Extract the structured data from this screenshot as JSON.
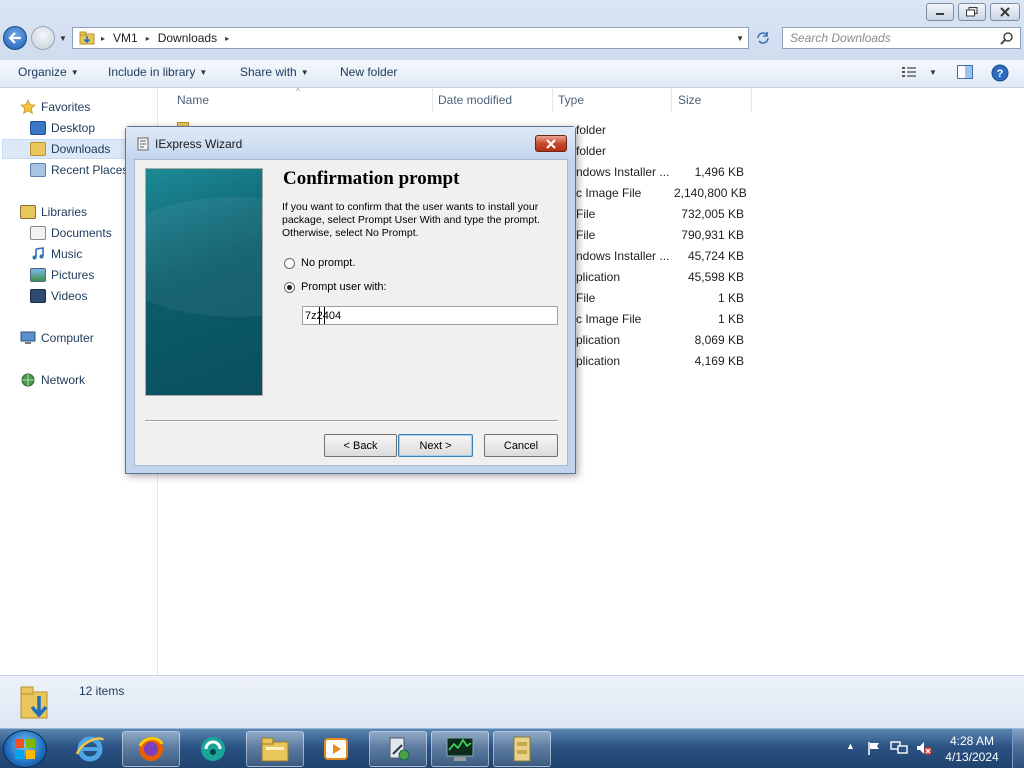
{
  "window": {
    "minimize_icon": "minimize-icon",
    "maximize_icon": "restore-icon",
    "close_icon": "close-icon"
  },
  "address": {
    "segments": [
      "VM1",
      "Downloads"
    ],
    "separator": "▸"
  },
  "search": {
    "placeholder": "Search Downloads"
  },
  "toolbar": {
    "organize": "Organize",
    "include_in_library": "Include in library",
    "share_with": "Share with",
    "new_folder": "New folder"
  },
  "nav": {
    "favorites": "Favorites",
    "desktop": "Desktop",
    "downloads": "Downloads",
    "recent_places": "Recent Places",
    "libraries": "Libraries",
    "documents": "Documents",
    "music": "Music",
    "pictures": "Pictures",
    "videos": "Videos",
    "computer": "Computer",
    "network": "Network"
  },
  "columns": {
    "name": "Name",
    "date_modified": "Date modified",
    "type": "Type",
    "size": "Size"
  },
  "files": [
    {
      "type": "folder",
      "size": ""
    },
    {
      "type": "folder",
      "size": ""
    },
    {
      "type": "ndows Installer ...",
      "size": "1,496 KB"
    },
    {
      "type": "c Image File",
      "size": "2,140,800 KB"
    },
    {
      "type": "File",
      "size": "732,005 KB"
    },
    {
      "type": "File",
      "size": "790,931 KB"
    },
    {
      "type": "ndows Installer ...",
      "size": "45,724 KB"
    },
    {
      "type": "plication",
      "size": "45,598 KB"
    },
    {
      "type": "File",
      "size": "1 KB"
    },
    {
      "type": "c Image File",
      "size": "1 KB"
    },
    {
      "type": "plication",
      "size": "8,069 KB"
    },
    {
      "type": "plication",
      "size": "4,169 KB"
    }
  ],
  "status": {
    "item_count": "12 items"
  },
  "dialog": {
    "title": "IExpress Wizard",
    "heading": "Confirmation prompt",
    "description": "If you want to confirm that the user wants to install your package, select Prompt User With and type the prompt. Otherwise, select No Prompt.",
    "option_no_prompt": "No prompt.",
    "option_prompt_user": "Prompt user with:",
    "selected_option": "prompt_user",
    "prompt_value": "7z2404",
    "back_label": "< Back",
    "next_label": "Next >",
    "cancel_label": "Cancel"
  },
  "taskbar": {
    "items": [
      "start-orb",
      "internet-explorer-icon",
      "firefox-icon",
      "app-icon",
      "explorer-icon",
      "media-player-icon",
      "iexpress-icon",
      "task-manager-icon",
      "cabinet-icon"
    ]
  },
  "clock": {
    "time": "4:28 AM",
    "date": "4/13/2024"
  },
  "colors": {
    "accent": "#1e395b",
    "dialog_banner": "#0b5c6c",
    "close_red": "#c84a2c",
    "taskbar": "#2a5283"
  }
}
